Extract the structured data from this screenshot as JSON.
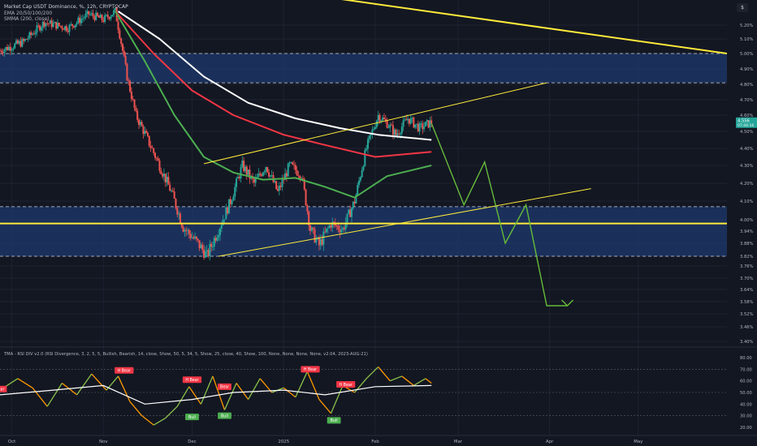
{
  "legend": {
    "title": "Market Cap USDT Dominance, %, 12h, CRYPTOCAP",
    "ema": "EMA 20/50/100/200",
    "smma": "SMMA (200, close)"
  },
  "scale_label": "$",
  "indicator_legend": "TMA - RSI DIV v2.0 (RSI Divergence, 3, 2, 5, 5, Bullish, Bearish, 14, close, Show, 50, 5, 34, 5, Show, 25, close, 40, Show, 100, None, None, None, None, v2.04, 2023-AUG-21)",
  "colors": {
    "background": "#131722",
    "up": "#26a69a",
    "down": "#ef5350",
    "white_ma": "#ffffff",
    "red_ma": "#f23645",
    "green_ma": "#4caf50",
    "yellow": "#ffeb3b",
    "zone": "#1e3a6e",
    "projection": "#66bb3a",
    "rsi": "#ff9800",
    "rsi_ma": "#ffffff",
    "bear_label": "#f23645",
    "bull_label": "#4caf50"
  },
  "chart_data": [
    {
      "type": "candlestick",
      "title": "Market Cap USDT Dominance, %, 12h, CRYPTOCAP",
      "x_axis_labels": [
        "Oct",
        "Nov",
        "Dec",
        "2025",
        "Feb",
        "Mar",
        "Apr",
        "May"
      ],
      "y_axis_labels": [
        "5.20%",
        "5.10%",
        "5.00%",
        "4.90%",
        "4.80%",
        "4.70%",
        "4.60%",
        "4.50%",
        "4.40%",
        "4.30%",
        "4.20%",
        "4.10%",
        "4.00%",
        "3.94%",
        "3.88%",
        "3.82%",
        "3.76%",
        "3.70%",
        "3.64%",
        "3.58%",
        "3.52%",
        "3.46%",
        "3.40%"
      ],
      "current_price": "4.556",
      "countdown": "07:44:16",
      "ylim": [
        3.4,
        5.3
      ],
      "price_path": {
        "dates": [
          "2024-09-27",
          "2024-10-05",
          "2024-10-12",
          "2024-10-20",
          "2024-10-27",
          "2024-11-01",
          "2024-11-05",
          "2024-11-09",
          "2024-11-12",
          "2024-11-16",
          "2024-11-20",
          "2024-11-24",
          "2024-11-28",
          "2024-12-03",
          "2024-12-06",
          "2024-12-10",
          "2024-12-14",
          "2024-12-18",
          "2024-12-22",
          "2024-12-26",
          "2024-12-30",
          "2025-01-03",
          "2025-01-07",
          "2025-01-10",
          "2025-01-13",
          "2025-01-17",
          "2025-01-21",
          "2025-01-25",
          "2025-01-29",
          "2025-02-02",
          "2025-02-05",
          "2025-02-08",
          "2025-02-12",
          "2025-02-16",
          "2025-02-20"
        ],
        "values": [
          5.02,
          5.08,
          5.22,
          5.18,
          5.28,
          5.24,
          5.3,
          4.85,
          4.6,
          4.45,
          4.3,
          4.15,
          3.96,
          3.88,
          3.82,
          3.95,
          4.1,
          4.3,
          4.2,
          4.3,
          4.15,
          4.3,
          4.25,
          3.95,
          3.87,
          3.98,
          3.95,
          4.1,
          4.4,
          4.6,
          4.55,
          4.48,
          4.58,
          4.52,
          4.556
        ]
      },
      "series": [
        {
          "name": "EMA 20/50/100/200",
          "dates": [
            "2024-11-06",
            "2024-11-20",
            "2024-12-05",
            "2024-12-20",
            "2025-01-05",
            "2025-01-20",
            "2025-02-02",
            "2025-02-20"
          ],
          "values": [
            5.3,
            5.1,
            4.85,
            4.68,
            4.58,
            4.52,
            4.48,
            4.45
          ]
        },
        {
          "name": "EMA 20/50/100/200",
          "dates": [
            "2024-11-05",
            "2024-11-18",
            "2024-12-01",
            "2024-12-15",
            "2025-01-01",
            "2025-01-15",
            "2025-02-01",
            "2025-02-20"
          ],
          "values": [
            5.3,
            5.0,
            4.76,
            4.6,
            4.48,
            4.42,
            4.35,
            4.38
          ]
        },
        {
          "name": "EMA 20/50/100/200",
          "dates": [
            "2024-11-05",
            "2024-11-15",
            "2024-11-25",
            "2024-12-05",
            "2024-12-15",
            "2024-12-25",
            "2025-01-05",
            "2025-01-15",
            "2025-01-25",
            "2025-02-05",
            "2025-02-20"
          ],
          "values": [
            5.3,
            4.95,
            4.6,
            4.35,
            4.26,
            4.22,
            4.23,
            4.18,
            4.12,
            4.24,
            4.3
          ]
        }
      ],
      "zones": [
        {
          "from": 4.81,
          "to": 5.0
        },
        {
          "from": 3.82,
          "to": 4.07
        }
      ],
      "trend_lines": [
        {
          "color": "yellow",
          "from": [
            "2024-12-05",
            4.31
          ],
          "to": [
            "2025-03-31",
            4.81
          ]
        },
        {
          "color": "yellow",
          "from": [
            "2024-12-10",
            3.82
          ],
          "to": [
            "2025-04-15",
            4.17
          ]
        },
        {
          "color": "yellow",
          "from": [
            "2024-09-27",
            3.98
          ],
          "to": [
            "2025-05-31",
            3.98
          ]
        },
        {
          "color": "yellow",
          "from": [
            "2025-01-10",
            5.42
          ],
          "to": [
            "2025-05-31",
            5.0
          ]
        }
      ],
      "projection": {
        "dates": [
          "2025-02-20",
          "2025-03-03",
          "2025-03-10",
          "2025-03-17",
          "2025-03-24",
          "2025-03-31",
          "2025-04-07"
        ],
        "values": [
          4.55,
          4.08,
          4.32,
          3.88,
          4.08,
          3.56,
          3.56
        ]
      }
    },
    {
      "type": "line",
      "title": "TMA - RSI DIV v2.0",
      "y_axis_labels": [
        "80.00",
        "70.00",
        "60.00",
        "50.00",
        "40.00",
        "30.00",
        "20.00"
      ],
      "ylim": [
        15,
        85
      ],
      "series": [
        {
          "name": "RSI",
          "dates": [
            "2024-09-27",
            "2024-10-03",
            "2024-10-08",
            "2024-10-13",
            "2024-10-18",
            "2024-10-23",
            "2024-10-28",
            "2024-11-02",
            "2024-11-06",
            "2024-11-10",
            "2024-11-14",
            "2024-11-18",
            "2024-11-22",
            "2024-11-26",
            "2024-11-30",
            "2024-12-04",
            "2024-12-08",
            "2024-12-12",
            "2024-12-16",
            "2024-12-20",
            "2024-12-24",
            "2024-12-28",
            "2025-01-01",
            "2025-01-05",
            "2025-01-09",
            "2025-01-13",
            "2025-01-17",
            "2025-01-21",
            "2025-01-25",
            "2025-01-29",
            "2025-02-02",
            "2025-02-06",
            "2025-02-10",
            "2025-02-14",
            "2025-02-18",
            "2025-02-20"
          ],
          "values": [
            52,
            62,
            54,
            38,
            58,
            48,
            66,
            52,
            64,
            42,
            30,
            22,
            28,
            38,
            55,
            40,
            64,
            35,
            58,
            44,
            62,
            50,
            54,
            46,
            68,
            44,
            32,
            56,
            50,
            62,
            72,
            60,
            64,
            56,
            62,
            58
          ]
        },
        {
          "name": "RSI MA",
          "dates": [
            "2024-09-27",
            "2024-10-15",
            "2024-11-01",
            "2024-11-15",
            "2024-12-01",
            "2024-12-15",
            "2025-01-01",
            "2025-01-15",
            "2025-02-01",
            "2025-02-20"
          ],
          "values": [
            48,
            52,
            56,
            40,
            44,
            50,
            52,
            48,
            55,
            56
          ]
        }
      ],
      "labels": [
        {
          "text": "H Bear",
          "date": "2024-11-08",
          "value": 69
        },
        {
          "text": "H Bear",
          "date": "2024-12-01",
          "value": 61
        },
        {
          "text": "Bear",
          "date": "2024-12-12",
          "value": 55
        },
        {
          "text": "H Bear",
          "date": "2025-01-10",
          "value": 70
        },
        {
          "text": "H Bear",
          "date": "2025-01-22",
          "value": 57
        },
        {
          "text": "Bear",
          "date": "2024-09-27",
          "value": 53
        },
        {
          "text": "Bull",
          "date": "2024-12-01",
          "value": 29
        },
        {
          "text": "Bull",
          "date": "2024-12-12",
          "value": 30
        },
        {
          "text": "Bull",
          "date": "2025-01-18",
          "value": 26
        }
      ]
    }
  ]
}
